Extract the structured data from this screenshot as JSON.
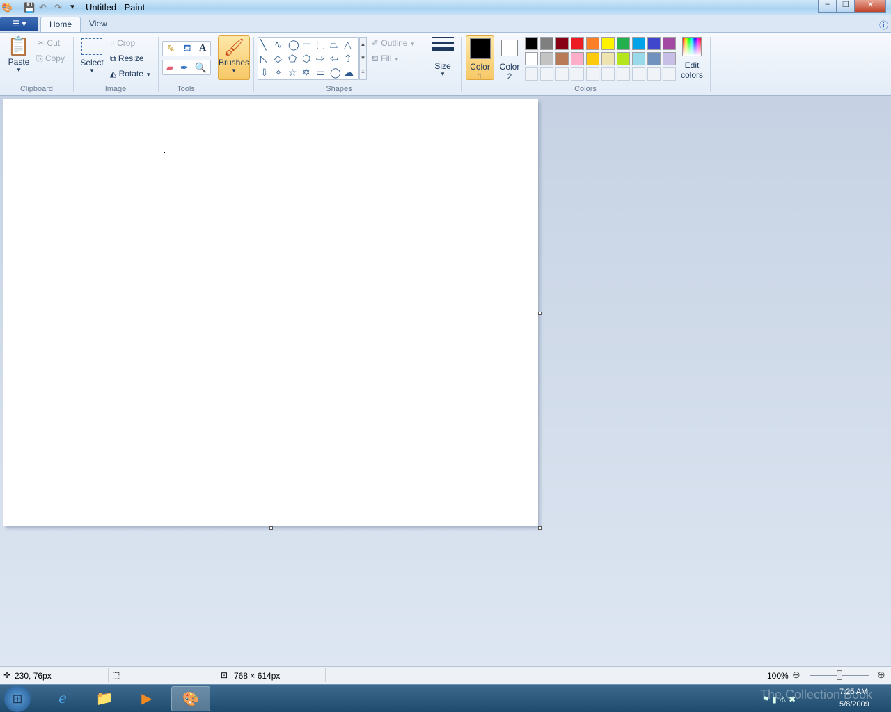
{
  "window": {
    "title": "Untitled - Paint"
  },
  "tabs": [
    {
      "label": "Home"
    },
    {
      "label": "View"
    }
  ],
  "clipboard": {
    "paste": "Paste",
    "cut": "Cut",
    "copy": "Copy",
    "group": "Clipboard"
  },
  "image": {
    "select": "Select",
    "crop": "Crop",
    "resize": "Resize",
    "rotate": "Rotate",
    "group": "Image"
  },
  "tools": {
    "group": "Tools"
  },
  "brushes": {
    "label": "Brushes"
  },
  "shapes": {
    "outline": "Outline",
    "fill": "Fill",
    "group": "Shapes",
    "glyphs": [
      "╲",
      "∿",
      "◯",
      "▭",
      "▢",
      "⏢",
      "△",
      "◺",
      "◇",
      "⬠",
      "⬡",
      "⇨",
      "⇦",
      "⇧",
      "⇩",
      "✧",
      "☆",
      "✡",
      "▭",
      "◯",
      "☁"
    ]
  },
  "size": {
    "label": "Size"
  },
  "colors": {
    "color1": "Color",
    "color1_num": "1",
    "color2": "Color",
    "color2_num": "2",
    "edit": "Edit",
    "edit2": "colors",
    "group": "Colors",
    "color1_value": "#000000",
    "color2_value": "#ffffff",
    "palette": [
      "#000000",
      "#7f7f7f",
      "#880015",
      "#ed1c24",
      "#ff7f27",
      "#fff200",
      "#22b14c",
      "#00a2e8",
      "#3f48cc",
      "#a349a4",
      "#ffffff",
      "#c3c3c3",
      "#b97a57",
      "#ffaec9",
      "#ffc90e",
      "#efe4b0",
      "#b5e61d",
      "#99d9ea",
      "#7092be",
      "#c8bfe7"
    ]
  },
  "status": {
    "cursor": "230, 76px",
    "size": "768 × 614px",
    "zoom": "100%",
    "zoom_percent": 100
  },
  "taskbar": {
    "time": "7:25 AM",
    "date": "5/8/2009",
    "watermark": "The Collection Book"
  }
}
